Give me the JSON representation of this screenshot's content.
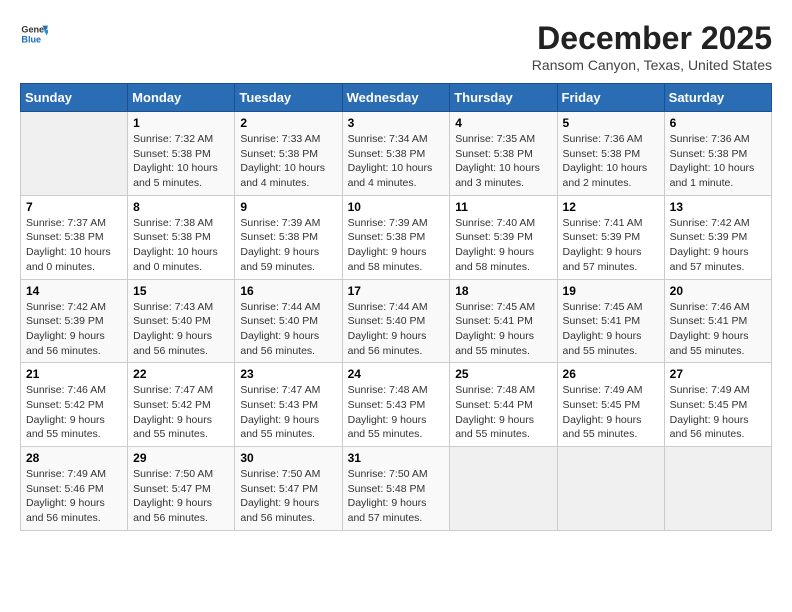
{
  "header": {
    "logo_line1": "General",
    "logo_line2": "Blue",
    "title": "December 2025",
    "subtitle": "Ransom Canyon, Texas, United States"
  },
  "days_of_week": [
    "Sunday",
    "Monday",
    "Tuesday",
    "Wednesday",
    "Thursday",
    "Friday",
    "Saturday"
  ],
  "weeks": [
    [
      {
        "day": "",
        "info": ""
      },
      {
        "day": "1",
        "info": "Sunrise: 7:32 AM\nSunset: 5:38 PM\nDaylight: 10 hours\nand 5 minutes."
      },
      {
        "day": "2",
        "info": "Sunrise: 7:33 AM\nSunset: 5:38 PM\nDaylight: 10 hours\nand 4 minutes."
      },
      {
        "day": "3",
        "info": "Sunrise: 7:34 AM\nSunset: 5:38 PM\nDaylight: 10 hours\nand 4 minutes."
      },
      {
        "day": "4",
        "info": "Sunrise: 7:35 AM\nSunset: 5:38 PM\nDaylight: 10 hours\nand 3 minutes."
      },
      {
        "day": "5",
        "info": "Sunrise: 7:36 AM\nSunset: 5:38 PM\nDaylight: 10 hours\nand 2 minutes."
      },
      {
        "day": "6",
        "info": "Sunrise: 7:36 AM\nSunset: 5:38 PM\nDaylight: 10 hours\nand 1 minute."
      }
    ],
    [
      {
        "day": "7",
        "info": "Sunrise: 7:37 AM\nSunset: 5:38 PM\nDaylight: 10 hours\nand 0 minutes."
      },
      {
        "day": "8",
        "info": "Sunrise: 7:38 AM\nSunset: 5:38 PM\nDaylight: 10 hours\nand 0 minutes."
      },
      {
        "day": "9",
        "info": "Sunrise: 7:39 AM\nSunset: 5:38 PM\nDaylight: 9 hours\nand 59 minutes."
      },
      {
        "day": "10",
        "info": "Sunrise: 7:39 AM\nSunset: 5:38 PM\nDaylight: 9 hours\nand 58 minutes."
      },
      {
        "day": "11",
        "info": "Sunrise: 7:40 AM\nSunset: 5:39 PM\nDaylight: 9 hours\nand 58 minutes."
      },
      {
        "day": "12",
        "info": "Sunrise: 7:41 AM\nSunset: 5:39 PM\nDaylight: 9 hours\nand 57 minutes."
      },
      {
        "day": "13",
        "info": "Sunrise: 7:42 AM\nSunset: 5:39 PM\nDaylight: 9 hours\nand 57 minutes."
      }
    ],
    [
      {
        "day": "14",
        "info": "Sunrise: 7:42 AM\nSunset: 5:39 PM\nDaylight: 9 hours\nand 56 minutes."
      },
      {
        "day": "15",
        "info": "Sunrise: 7:43 AM\nSunset: 5:40 PM\nDaylight: 9 hours\nand 56 minutes."
      },
      {
        "day": "16",
        "info": "Sunrise: 7:44 AM\nSunset: 5:40 PM\nDaylight: 9 hours\nand 56 minutes."
      },
      {
        "day": "17",
        "info": "Sunrise: 7:44 AM\nSunset: 5:40 PM\nDaylight: 9 hours\nand 56 minutes."
      },
      {
        "day": "18",
        "info": "Sunrise: 7:45 AM\nSunset: 5:41 PM\nDaylight: 9 hours\nand 55 minutes."
      },
      {
        "day": "19",
        "info": "Sunrise: 7:45 AM\nSunset: 5:41 PM\nDaylight: 9 hours\nand 55 minutes."
      },
      {
        "day": "20",
        "info": "Sunrise: 7:46 AM\nSunset: 5:41 PM\nDaylight: 9 hours\nand 55 minutes."
      }
    ],
    [
      {
        "day": "21",
        "info": "Sunrise: 7:46 AM\nSunset: 5:42 PM\nDaylight: 9 hours\nand 55 minutes."
      },
      {
        "day": "22",
        "info": "Sunrise: 7:47 AM\nSunset: 5:42 PM\nDaylight: 9 hours\nand 55 minutes."
      },
      {
        "day": "23",
        "info": "Sunrise: 7:47 AM\nSunset: 5:43 PM\nDaylight: 9 hours\nand 55 minutes."
      },
      {
        "day": "24",
        "info": "Sunrise: 7:48 AM\nSunset: 5:43 PM\nDaylight: 9 hours\nand 55 minutes."
      },
      {
        "day": "25",
        "info": "Sunrise: 7:48 AM\nSunset: 5:44 PM\nDaylight: 9 hours\nand 55 minutes."
      },
      {
        "day": "26",
        "info": "Sunrise: 7:49 AM\nSunset: 5:45 PM\nDaylight: 9 hours\nand 55 minutes."
      },
      {
        "day": "27",
        "info": "Sunrise: 7:49 AM\nSunset: 5:45 PM\nDaylight: 9 hours\nand 56 minutes."
      }
    ],
    [
      {
        "day": "28",
        "info": "Sunrise: 7:49 AM\nSunset: 5:46 PM\nDaylight: 9 hours\nand 56 minutes."
      },
      {
        "day": "29",
        "info": "Sunrise: 7:50 AM\nSunset: 5:47 PM\nDaylight: 9 hours\nand 56 minutes."
      },
      {
        "day": "30",
        "info": "Sunrise: 7:50 AM\nSunset: 5:47 PM\nDaylight: 9 hours\nand 56 minutes."
      },
      {
        "day": "31",
        "info": "Sunrise: 7:50 AM\nSunset: 5:48 PM\nDaylight: 9 hours\nand 57 minutes."
      },
      {
        "day": "",
        "info": ""
      },
      {
        "day": "",
        "info": ""
      },
      {
        "day": "",
        "info": ""
      }
    ]
  ]
}
